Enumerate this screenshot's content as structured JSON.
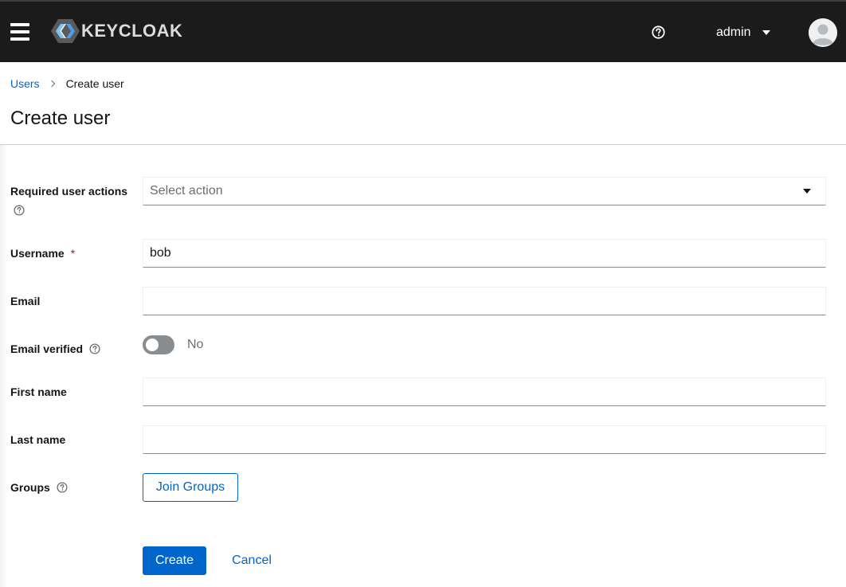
{
  "header": {
    "brand": "KEYCLOAK",
    "user_name": "admin",
    "icons": {
      "menu": "hamburger-menu-icon",
      "help": "help-circle-icon",
      "user_caret": "caret-down-icon",
      "avatar": "user-avatar-icon"
    },
    "colors": {
      "background": "#1b1b1b",
      "logo_accent": "#4d9ee6"
    }
  },
  "breadcrumb": {
    "parent": "Users",
    "current": "Create user"
  },
  "page": {
    "title": "Create user"
  },
  "form": {
    "required_actions": {
      "label": "Required user actions",
      "placeholder": "Select action"
    },
    "username": {
      "label": "Username",
      "required_mark": "*",
      "value": "bob"
    },
    "email": {
      "label": "Email",
      "value": ""
    },
    "email_verified": {
      "label": "Email verified",
      "state": "No",
      "checked": false
    },
    "first_name": {
      "label": "First name",
      "value": ""
    },
    "last_name": {
      "label": "Last name",
      "value": ""
    },
    "groups": {
      "label": "Groups",
      "button": "Join Groups"
    }
  },
  "actions": {
    "create": "Create",
    "cancel": "Cancel"
  },
  "colors": {
    "primary": "#0066cc",
    "required": "#c9190b",
    "toggle_off": "#8a8d90"
  }
}
